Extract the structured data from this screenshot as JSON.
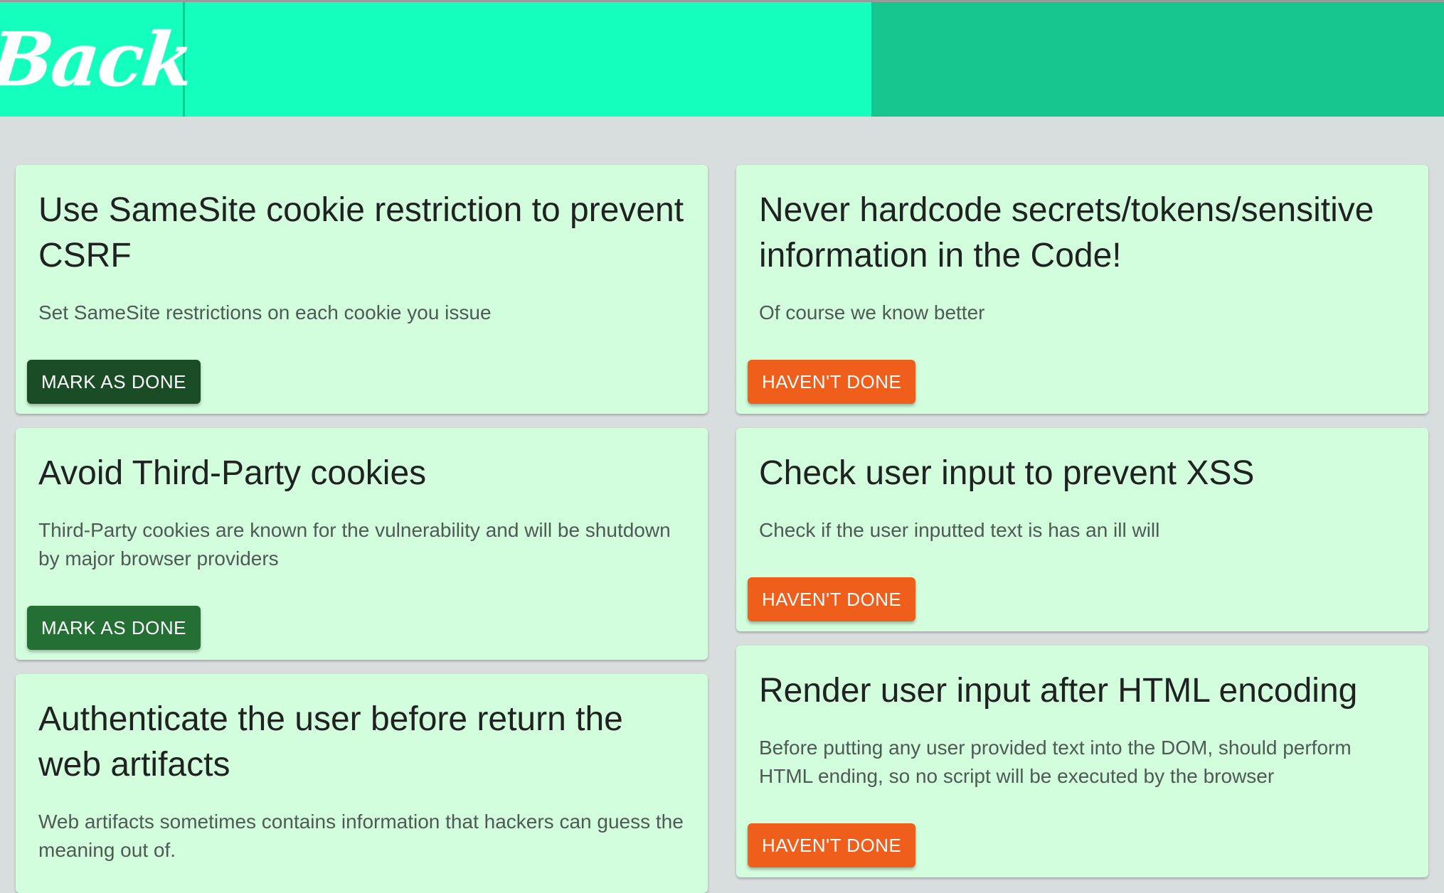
{
  "header": {
    "back_label": "Back",
    "colors": {
      "left": "#14ffbd",
      "right": "#16c68e"
    }
  },
  "cards": {
    "left": [
      {
        "title": "Use SameSite cookie restriction to prevent CSRF",
        "description": "Set SameSite restrictions on each cookie you issue",
        "button_label": "MARK AS DONE",
        "button_state": "hover"
      },
      {
        "title": "Avoid Third-Party cookies",
        "description": "Third-Party cookies are known for the vulnerability and will be shutdown by major browser providers",
        "button_label": "MARK AS DONE",
        "button_state": "default"
      },
      {
        "title": "Authenticate the user before return the web artifacts",
        "description": "Web artifacts sometimes contains information that hackers can guess the meaning out of."
      }
    ],
    "right": [
      {
        "title": "Never hardcode secrets/tokens/sensitive information in the Code!",
        "description": "Of course we know better",
        "button_label": "HAVEN'T DONE"
      },
      {
        "title": "Check user input to prevent XSS",
        "description": "Check if the user inputted text is has an ill will",
        "button_label": "HAVEN'T DONE"
      },
      {
        "title": "Render user input after HTML encoding",
        "description": "Before putting any user provided text into the DOM, should perform HTML ending, so no script will be executed by the browser",
        "button_label": "HAVEN'T DONE"
      }
    ]
  },
  "button_colors": {
    "mark_done_hover": "#1a4d26",
    "mark_done": "#246f33",
    "havent_done": "#f05e1c"
  }
}
